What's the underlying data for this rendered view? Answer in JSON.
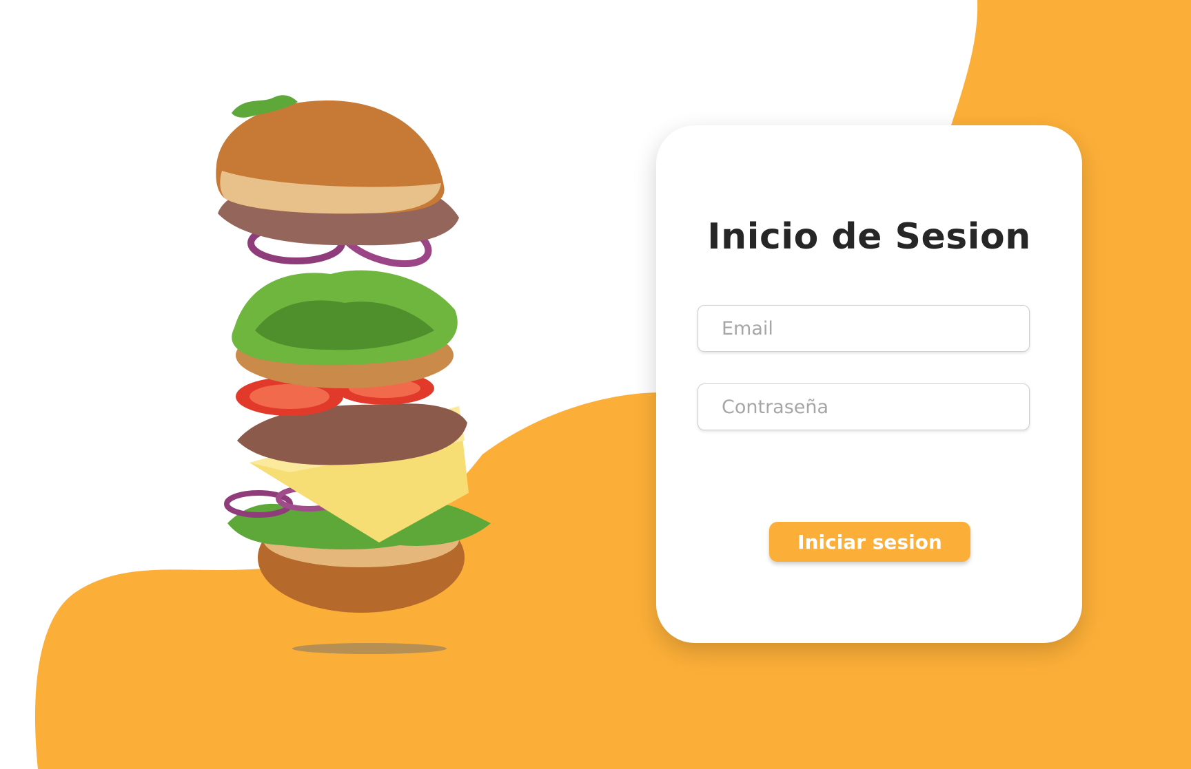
{
  "colors": {
    "accent": "#fcaf38",
    "background": "#ffffff",
    "card": "#ffffff",
    "title_text": "#262626",
    "placeholder_text": "#a6a6a6",
    "button_text": "#ffffff"
  },
  "hero": {
    "image": "floating-burger-illustration"
  },
  "login": {
    "title": "Inicio de Sesion",
    "email": {
      "value": "",
      "placeholder": "Email"
    },
    "password": {
      "value": "",
      "placeholder": "Contraseña"
    },
    "submit_label": "Iniciar sesion"
  }
}
